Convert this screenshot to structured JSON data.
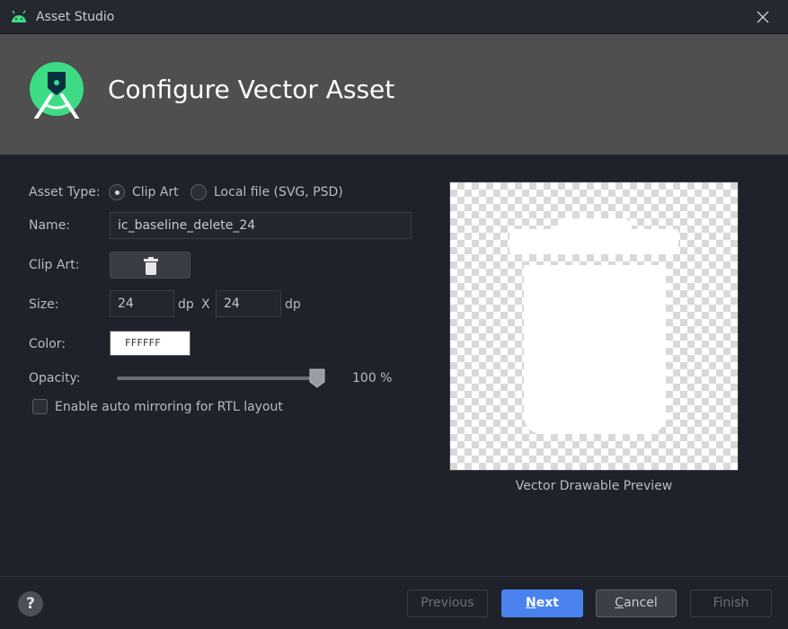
{
  "window": {
    "title": "Asset Studio",
    "icon": "android-icon",
    "close_icon": "close-icon"
  },
  "header": {
    "heading": "Configure Vector Asset",
    "logo": "android-studio-logo"
  },
  "form": {
    "asset_type": {
      "label": "Asset Type:",
      "options": [
        {
          "label": "Clip Art",
          "selected": true
        },
        {
          "label": "Local file (SVG, PSD)",
          "selected": false
        }
      ]
    },
    "name": {
      "label": "Name:",
      "value": "ic_baseline_delete_24"
    },
    "clip_art": {
      "label": "Clip Art:",
      "icon": "delete-icon"
    },
    "size": {
      "label": "Size:",
      "width": "24",
      "height": "24",
      "unit": "dp",
      "separator": "X"
    },
    "color": {
      "label": "Color:",
      "value": "FFFFFF"
    },
    "opacity": {
      "label": "Opacity:",
      "value_text": "100 %",
      "fraction": 1.0
    },
    "rtl_mirroring": {
      "label": "Enable auto mirroring for RTL layout",
      "checked": false
    }
  },
  "preview": {
    "caption": "Vector Drawable Preview",
    "icon": "delete-icon"
  },
  "footer": {
    "help_label": "?",
    "buttons": {
      "previous": {
        "label": "Previous",
        "enabled": false
      },
      "next": {
        "label_mnemonic": "N",
        "label_rest": "ext",
        "enabled": true
      },
      "cancel": {
        "label_mnemonic": "C",
        "label_rest": "ancel",
        "enabled": true
      },
      "finish": {
        "label": "Finish",
        "enabled": false
      }
    }
  },
  "colors": {
    "background": "#1f222a",
    "header_background": "#4f4f4f",
    "accent": "#4a82f0",
    "android_green": "#3ddc84"
  }
}
